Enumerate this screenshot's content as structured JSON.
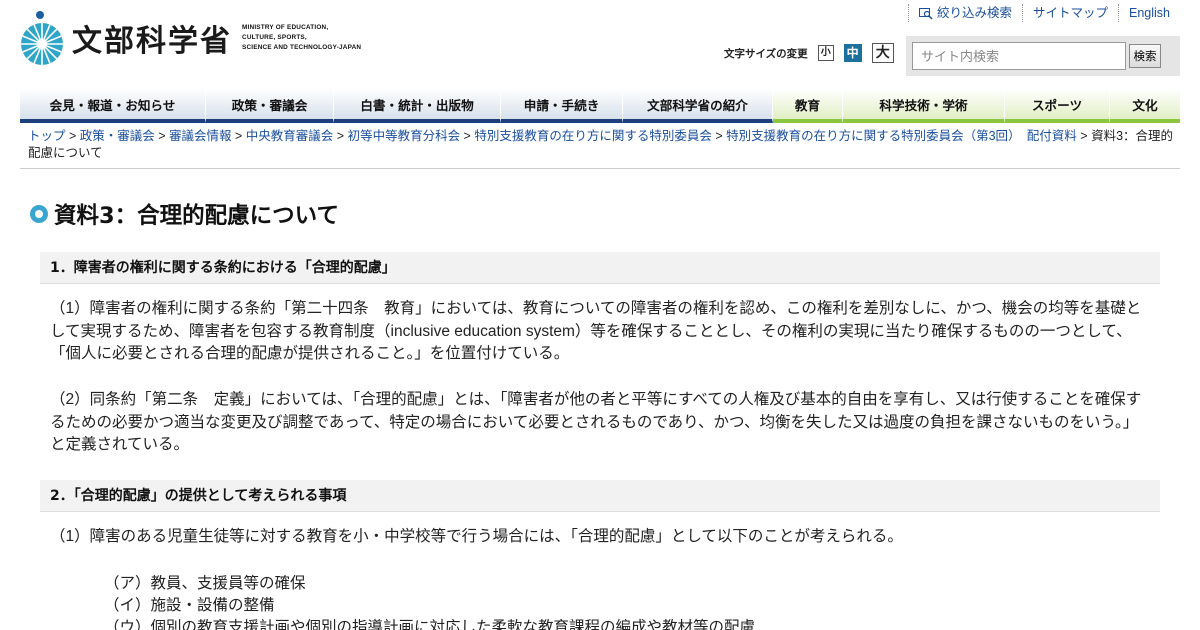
{
  "header": {
    "logo_jp": "文部科学省",
    "logo_en": [
      "MINISTRY OF EDUCATION,",
      "CULTURE, SPORTS,",
      "SCIENCE AND TECHNOLOGY-JAPAN"
    ],
    "util_links": [
      {
        "label": "絞り込み検索",
        "icon": "magnifier-icon"
      },
      {
        "label": "サイトマップ"
      },
      {
        "label": "English"
      }
    ],
    "fontsize": {
      "label": "文字サイズの変更",
      "small": "小",
      "medium": "中",
      "large": "大",
      "active": "中"
    },
    "search": {
      "placeholder": "サイト内検索",
      "value": "",
      "button": "検索"
    }
  },
  "nav": {
    "items": [
      {
        "label": "会見・報道・お知らせ",
        "group": "blue"
      },
      {
        "label": "政策・審議会",
        "group": "blue"
      },
      {
        "label": "白書・統計・出版物",
        "group": "blue"
      },
      {
        "label": "申請・手続き",
        "group": "blue"
      },
      {
        "label": "文部科学省の紹介",
        "group": "blue"
      },
      {
        "label": "教育",
        "group": "green"
      },
      {
        "label": "科学技術・学術",
        "group": "green"
      },
      {
        "label": "スポーツ",
        "group": "green"
      },
      {
        "label": "文化",
        "group": "green"
      }
    ],
    "colors": {
      "blue": "#1c3f7d",
      "green": "#8cc63f"
    }
  },
  "breadcrumb": {
    "links": [
      "トップ",
      "政策・審議会",
      "審議会情報",
      "中央教育審議会",
      "初等中等教育分科会",
      "特別支援教育の在り方に関する特別委員会",
      "特別支援教育の在り方に関する特別委員会（第3回）　配付資料"
    ],
    "current": "資料3：合理的配慮について",
    "separator": " > "
  },
  "main": {
    "title": "資料3：合理的配慮について",
    "sections": [
      {
        "heading": "1．障害者の権利に関する条約における「合理的配慮」",
        "paragraphs": [
          "（1）障害者の権利に関する条約「第二十四条　教育」においては、教育についての障害者の権利を認め、この権利を差別なしに、かつ、機会の均等を基礎として実現するため、障害者を包容する教育制度（inclusive education system）等を確保することとし、その権利の実現に当たり確保するものの一つとして、「個人に必要とされる合理的配慮が提供されること。」を位置付けている。",
          "（2）同条約「第二条　定義」においては、「合理的配慮」とは、「障害者が他の者と平等にすべての人権及び基本的自由を享有し、又は行使することを確保するための必要かつ適当な変更及び調整であって、特定の場合において必要とされるものであり、かつ、均衡を失した又は過度の負担を課さないものをいう。」と定義されている。"
        ]
      },
      {
        "heading": "2．「合理的配慮」の提供として考えられる事項",
        "paragraphs": [
          "（1）障害のある児童生徒等に対する教育を小・中学校等で行う場合には、「合理的配慮」として以下のことが考えられる。"
        ],
        "list": [
          "（ア）教員、支援員等の確保",
          "（イ）施設・設備の整備",
          "（ウ）個別の教育支援計画や個別の指導計画に対応した柔軟な教育課程の編成や教材等の配慮"
        ]
      }
    ]
  }
}
